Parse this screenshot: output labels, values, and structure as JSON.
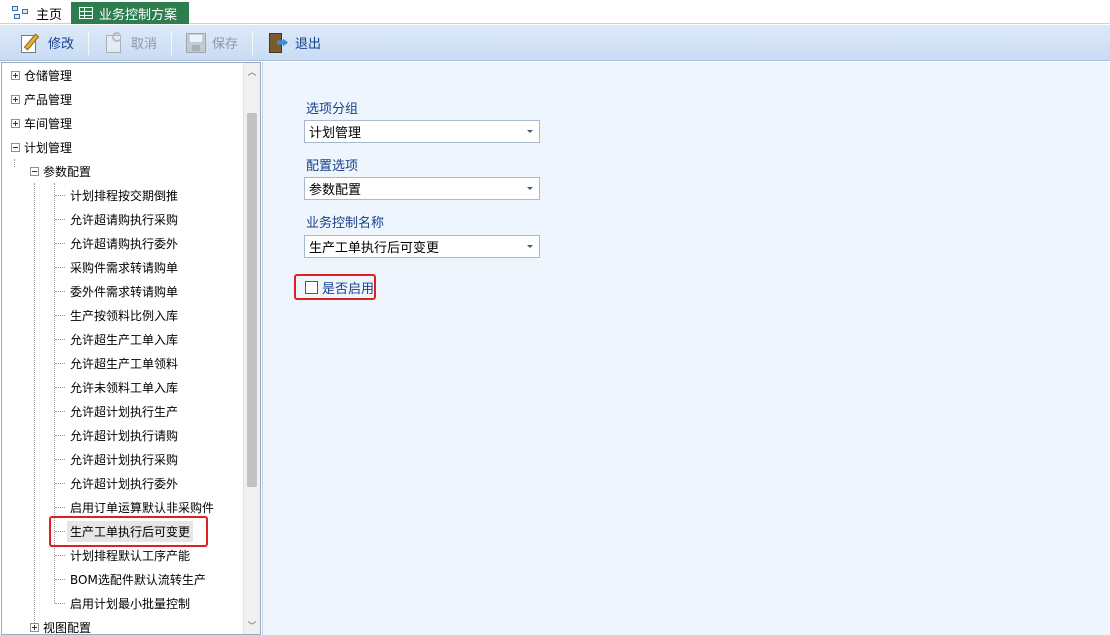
{
  "tabs": {
    "home_label": "主页",
    "active_label": "业务控制方案"
  },
  "toolbar": {
    "edit_label": "修改",
    "cancel_label": "取消",
    "save_label": "保存",
    "exit_label": "退出"
  },
  "tree": {
    "top_level": [
      "仓储管理",
      "产品管理",
      "车间管理",
      "计划管理"
    ],
    "plan_children": {
      "param_config": "参数配置",
      "view_config": "视图配置"
    },
    "param_items": [
      "计划排程按交期倒推",
      "允许超请购执行采购",
      "允许超请购执行委外",
      "采购件需求转请购单",
      "委外件需求转请购单",
      "生产按领料比例入库",
      "允许超生产工单入库",
      "允许超生产工单领料",
      "允许未领料工单入库",
      "允许超计划执行生产",
      "允许超计划执行请购",
      "允许超计划执行采购",
      "允许超计划执行委外",
      "启用订单运算默认非采购件",
      "生产工单执行后可变更",
      "计划排程默认工序产能",
      "BOM选配件默认流转生产",
      "启用计划最小批量控制"
    ],
    "selected_item": "生产工单执行后可变更"
  },
  "form": {
    "group_label": "选项分组",
    "group_value": "计划管理",
    "config_label": "配置选项",
    "config_value": "参数配置",
    "control_name_label": "业务控制名称",
    "control_name_value": "生产工单执行后可变更",
    "enabled_label": "是否启用",
    "enabled": false
  },
  "colors": {
    "active_tab": "#2e7d4f",
    "label_blue": "#15428b",
    "highlight_red": "#e02020",
    "content_bg": "#eff5fd"
  }
}
